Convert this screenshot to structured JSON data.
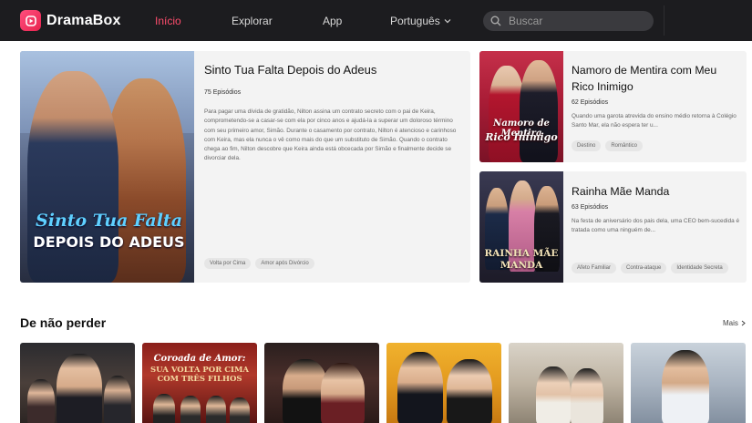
{
  "header": {
    "brand": "DramaBox",
    "nav": [
      "Início",
      "Explorar",
      "App"
    ],
    "language": "Português",
    "search_placeholder": "Buscar",
    "accent_color": "#ff4d6d"
  },
  "featured": {
    "title": "Sinto Tua Falta Depois do Adeus",
    "episodes": "75 Episódios",
    "description": "Para pagar uma dívida de gratidão, Nilton assina um contrato secreto com o pai de Keira, comprometendo-se a casar-se com ela por cinco anos e ajudá-la a superar um doloroso término com seu primeiro amor, Simão. Durante o casamento por contrato, Nilton é atencioso e carinhoso com Keira, mas ela nunca o vê como mais do que um substituto de Simão. Quando o contrato chega ao fim, Nilton descobre que Keira ainda está obcecada por Simão e finalmente decide se divorciar dela.",
    "tags": [
      "Volta por Cima",
      "Amor após Divórcio"
    ],
    "poster_line1": "Sinto Tua Falta",
    "poster_line2": "DEPOIS DO ADEUS"
  },
  "side_cards": [
    {
      "title": "Namoro de Mentira com Meu Rico Inimigo",
      "episodes": "62 Episódios",
      "description": "Quando uma garota atrevida do ensino médio retorna à Colégio Santo Mar, ela não espera ter u...",
      "tags": [
        "Destino",
        "Romântico"
      ],
      "poster_line1": "Namoro de Mentira",
      "poster_line2": "Rico Inimigo"
    },
    {
      "title": "Rainha Mãe Manda",
      "episodes": "63 Episódios",
      "description": "Na festa de aniversário dos pais dela, uma CEO bem-sucedida é tratada como uma ninguém de...",
      "tags": [
        "Afeto Familiar",
        "Contra-ataque",
        "Identidade Secreta"
      ],
      "poster_line1": "RAINHA MÃE",
      "poster_line2": "MANDA"
    }
  ],
  "section": {
    "title": "De não perder",
    "more_label": "Mais"
  },
  "row_posters": [
    {
      "line1": "",
      "line2": ""
    },
    {
      "line1": "Coroada de Amor:",
      "line2": "SUA VOLTA POR CIMA COM TRÊS FILHOS"
    },
    {
      "line1": "",
      "line2": ""
    },
    {
      "line1": "",
      "line2": ""
    },
    {
      "line1": "",
      "line2": ""
    },
    {
      "line1": "",
      "line2": ""
    }
  ]
}
